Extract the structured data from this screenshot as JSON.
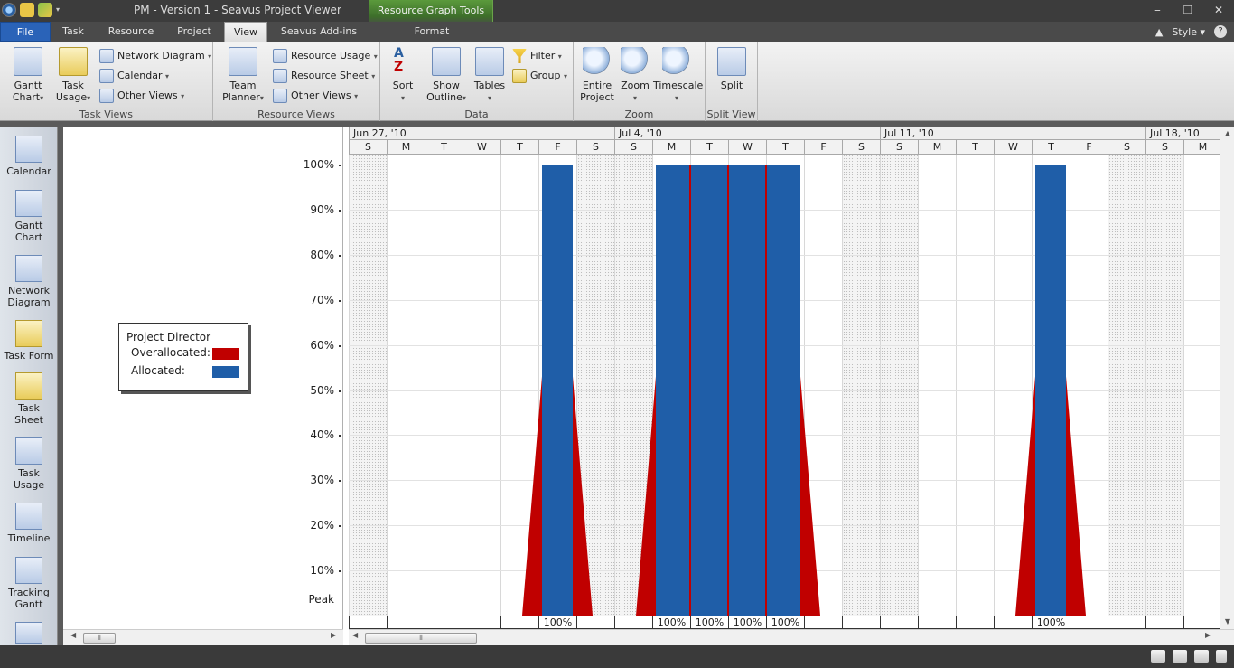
{
  "window": {
    "title": "PM - Version 1 - Seavus Project Viewer",
    "context_group": "Resource Graph Tools",
    "style_label": "Style"
  },
  "tabs": [
    "File",
    "Task",
    "Resource",
    "Project",
    "View",
    "Seavus Add-ins",
    "Format"
  ],
  "active_tab": "View",
  "ribbon": {
    "task_views": {
      "label": "Task Views",
      "gantt": "Gantt\nChart",
      "task_usage": "Task\nUsage",
      "network_diagram": "Network Diagram",
      "calendar": "Calendar",
      "other_views": "Other Views"
    },
    "resource_views": {
      "label": "Resource Views",
      "team_planner": "Team\nPlanner",
      "resource_usage": "Resource Usage",
      "resource_sheet": "Resource Sheet",
      "other_views": "Other Views"
    },
    "data": {
      "label": "Data",
      "sort": "Sort",
      "show_outline": "Show\nOutline",
      "tables": "Tables",
      "filter": "Filter",
      "group": "Group"
    },
    "zoom": {
      "label": "Zoom",
      "entire_project": "Entire\nProject",
      "zoom": "Zoom",
      "timescale": "Timescale"
    },
    "split_view": {
      "label": "Split View",
      "split": "Split"
    }
  },
  "sidebar": [
    {
      "label": "Calendar",
      "icon": "calendar-icon"
    },
    {
      "label": "Gantt\nChart",
      "icon": "gantt-chart-icon"
    },
    {
      "label": "Network\nDiagram",
      "icon": "network-diagram-icon"
    },
    {
      "label": "Task Form",
      "icon": "task-form-icon"
    },
    {
      "label": "Task\nSheet",
      "icon": "task-sheet-icon"
    },
    {
      "label": "Task\nUsage",
      "icon": "task-usage-icon"
    },
    {
      "label": "Timeline",
      "icon": "timeline-icon"
    },
    {
      "label": "Tracking\nGantt",
      "icon": "tracking-gantt-icon"
    }
  ],
  "legend": {
    "title": "Project Director",
    "overallocated": "Overallocated:",
    "allocated": "Allocated:"
  },
  "colors": {
    "overallocated": "#c00000",
    "allocated": "#1f5ea8"
  },
  "timescale": {
    "weeks": [
      "Jun 27, '10",
      "Jul 4, '10",
      "Jul 11, '10",
      "Jul 18, '10"
    ],
    "days": [
      "S",
      "M",
      "T",
      "W",
      "T",
      "F",
      "S",
      "S",
      "M",
      "T",
      "W",
      "T",
      "F",
      "S",
      "S",
      "M",
      "T",
      "W",
      "T",
      "F",
      "S",
      "S",
      "M"
    ]
  },
  "chart_data": {
    "type": "bar",
    "ylabels": [
      "100%",
      "90%",
      "80%",
      "70%",
      "60%",
      "50%",
      "40%",
      "30%",
      "20%",
      "10%"
    ],
    "peak_label": "Peak",
    "ylim": [
      0,
      100
    ],
    "categories": [
      "Jun 27",
      "Jun 28",
      "Jun 29",
      "Jun 30",
      "Jul 1",
      "Jul 2",
      "Jul 3",
      "Jul 4",
      "Jul 5",
      "Jul 6",
      "Jul 7",
      "Jul 8",
      "Jul 9",
      "Jul 10",
      "Jul 11",
      "Jul 12",
      "Jul 13",
      "Jul 14",
      "Jul 15",
      "Jul 16",
      "Jul 17",
      "Jul 18",
      "Jul 19"
    ],
    "allocated": [
      0,
      0,
      0,
      0,
      0,
      100,
      0,
      0,
      100,
      100,
      100,
      100,
      0,
      0,
      0,
      0,
      0,
      0,
      100,
      0,
      0,
      0,
      0
    ],
    "totals": [
      "",
      "",
      "",
      "",
      "",
      "100%",
      "",
      "",
      "100%",
      "100%",
      "100%",
      "100%",
      "",
      "",
      "",
      "",
      "",
      "",
      "100%",
      "",
      "",
      "",
      ""
    ]
  }
}
